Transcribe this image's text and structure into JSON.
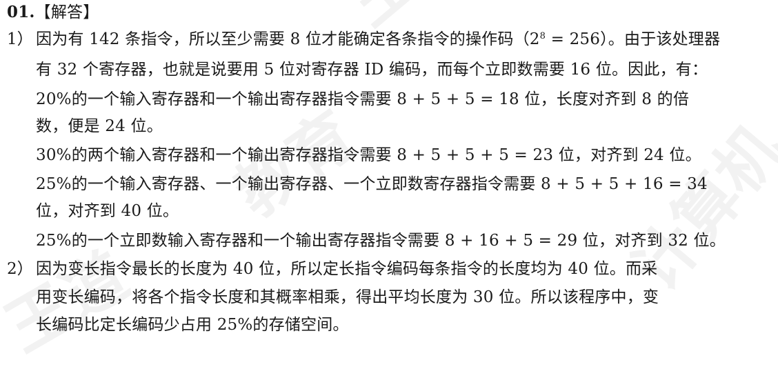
{
  "heading": {
    "number": "01.",
    "title": "【解答】"
  },
  "item1": {
    "label": "1）",
    "line1_a": "因为有 142 条指令，所以至少需要 8 位才能确定各条指令的操作码（2",
    "line1_sup": "8",
    "line1_b": " = 256）。由于该处理器",
    "line2": "有 32 个寄存器，也就是说要用 5 位对寄存器 ID 编码，而每个立即数需要 16 位。因此，有：",
    "case1_line1": "20%的一个输入寄存器和一个输出寄存器指令需要 8 + 5 + 5 = 18 位，长度对齐到 8 的倍",
    "case1_line2": "数，便是 24 位。",
    "case2_line1": "30%的两个输入寄存器和一个输出寄存器指令需要 8 + 5 + 5 + 5 = 23 位，对齐到 24 位。",
    "case3_line1": "25%的一个输入寄存器、一个输出寄存器、一个立即数寄存器指令需要 8 + 5 + 5 + 16 = 34",
    "case3_line2": "位，对齐到 40 位。",
    "case4_line1": "25%的一个立即数输入寄存器和一个输出寄存器指令需要 8 + 16 + 5 = 29 位，对齐到 32 位。"
  },
  "item2": {
    "label": "2）",
    "line1": "因为变长指令最长的长度为 40 位，所以定长指令编码每条指令的长度均为 40 位。而采",
    "line2": "用变长编码，将各个指令长度和其概率相乘，得出平均长度为 30 位。所以该程序中，变",
    "line3": "长编码比定长编码少占用 25%的存储空间。"
  }
}
